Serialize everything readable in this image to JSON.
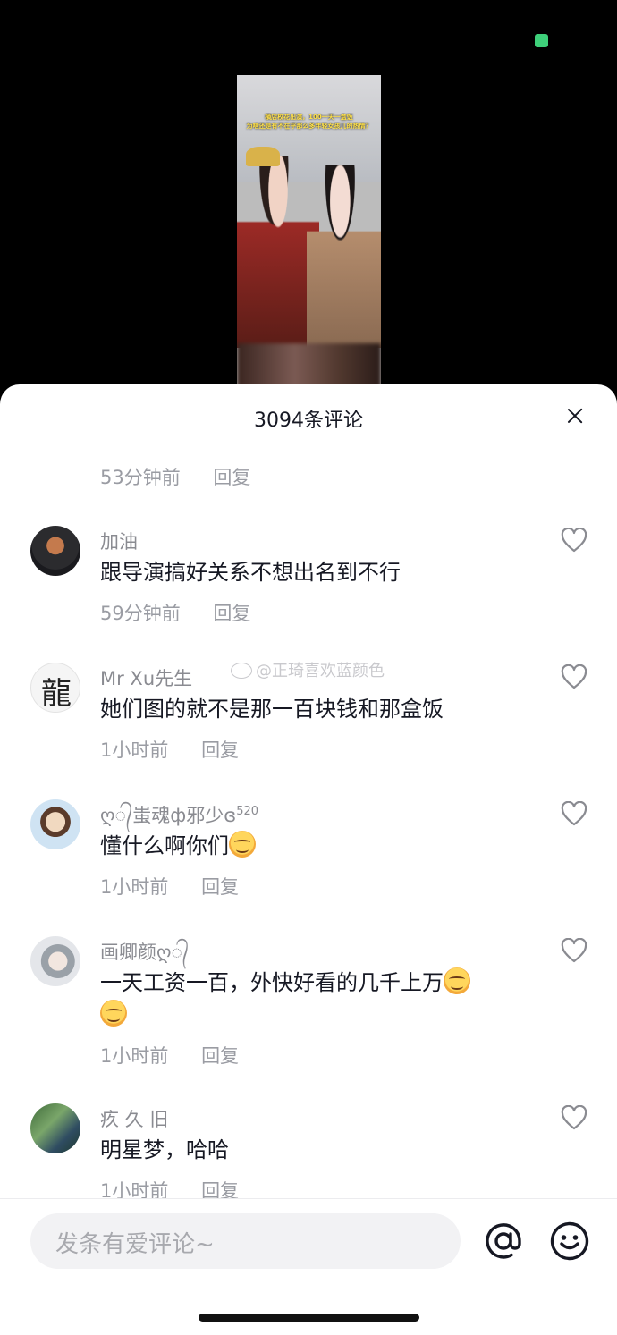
{
  "video": {
    "caption_line1": "横店校花出演，100一天一盒饭",
    "caption_line2": "为啥还是有不在乎那么多年轻女孩儿的热情？"
  },
  "comments_sheet": {
    "title": "3094条评论",
    "top_meta": {
      "time": "53分钟前",
      "reply": "回复"
    },
    "comments": [
      {
        "username": "加油",
        "text": "跟导演搞好关系不想出名到不行",
        "time": "59分钟前",
        "reply": "回复"
      },
      {
        "username": "Mr  Xu先生",
        "text": "她们图的就不是那一百块钱和那盒饭",
        "time": "1小时前",
        "reply": "回复",
        "avatar_glyph": "龍"
      },
      {
        "username": "ღ᭄蚩魂ф邪少ɞ",
        "username_sup": "520",
        "text": "懂什么啊你们",
        "time": "1小时前",
        "reply": "回复"
      },
      {
        "username": "画卿颜ღ᭄",
        "text": "一天工资一百，外快好看的几千上万",
        "time": "1小时前",
        "reply": "回复"
      },
      {
        "username": "疚 久 旧",
        "text": "明星梦，哈哈",
        "time": "1小时前",
        "reply": "回复"
      }
    ],
    "watermark": "@正琦喜欢蓝颜色"
  },
  "bottom_bar": {
    "input_placeholder": "发条有爱评论~"
  },
  "colors": {
    "accent_status": "#3ed07a",
    "text_primary": "#161823",
    "text_secondary": "#9a9ca3"
  },
  "icons": [
    "close-icon",
    "heart-icon",
    "at-icon",
    "emoji-icon",
    "smile-emoji-icon"
  ]
}
